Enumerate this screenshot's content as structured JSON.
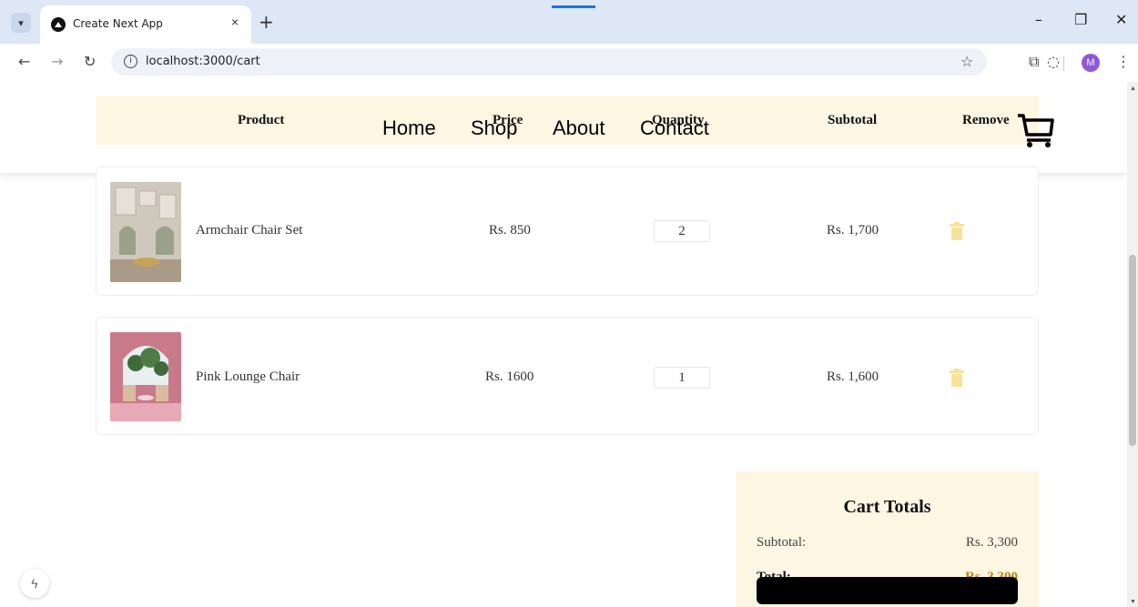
{
  "browser": {
    "tab_title": "Create Next App",
    "tab_close": "×",
    "new_tab": "+",
    "url": "localhost:3000/cart",
    "profile_initial": "M"
  },
  "nav": {
    "links": [
      "Home",
      "Shop",
      "About",
      "Contact"
    ]
  },
  "table_headers": [
    "Product",
    "Price",
    "Quantity",
    "Subtotal",
    "Remove"
  ],
  "cart_items": [
    {
      "name": "Armchair Chair Set",
      "price": "Rs. 850",
      "quantity": "2",
      "subtotal": "Rs. 1,700"
    },
    {
      "name": "Pink Lounge Chair",
      "price": "Rs. 1600",
      "quantity": "1",
      "subtotal": "Rs. 1,600"
    }
  ],
  "totals": {
    "title": "Cart Totals",
    "subtotal_label": "Subtotal:",
    "subtotal_value": "Rs. 3,300",
    "total_label": "Total:",
    "total_value": "Rs. 3,300"
  },
  "colors": {
    "header_bg": "#fdf6e3",
    "accent_gold": "#b8860b",
    "trash": "#f6e39a",
    "profile": "#8e59d8"
  }
}
